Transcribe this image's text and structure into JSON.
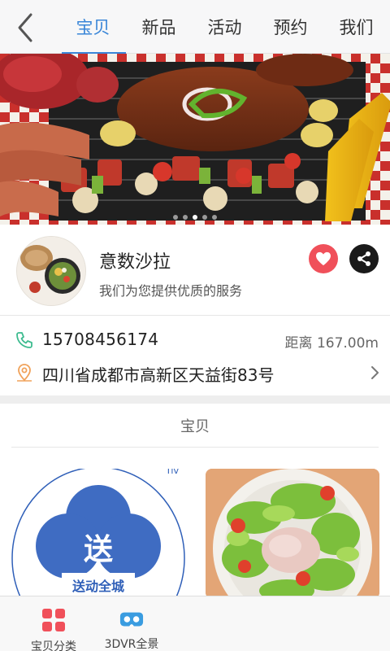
{
  "nav": {
    "tabs": [
      {
        "label": "宝贝",
        "active": true
      },
      {
        "label": "新品",
        "active": false
      },
      {
        "label": "活动",
        "active": false
      },
      {
        "label": "预约",
        "active": false
      },
      {
        "label": "我们",
        "active": false
      }
    ]
  },
  "banner": {
    "slide_count": 5,
    "active_slide": 2
  },
  "shop": {
    "name": "意数沙拉",
    "description": "我们为您提供优质的服务"
  },
  "contact": {
    "phone": "15708456174",
    "distance": "距离 167.00m",
    "address": "四川省成都市高新区天益街83号"
  },
  "section": {
    "title": "宝贝"
  },
  "products": [
    {
      "image_text": "送",
      "image_caption": "送动全城",
      "image_corner": "Tiv"
    },
    {
      "image_text": ""
    }
  ],
  "bottom_bar": {
    "items": [
      {
        "label": "宝贝分类",
        "icon": "grid-icon"
      },
      {
        "label": "3DVR全景",
        "icon": "vr-goggles-icon"
      }
    ]
  },
  "colors": {
    "accent": "#3a86d8",
    "like": "#f0505a",
    "phone_icon": "#3dbb8f",
    "location_icon": "#f0a25a",
    "category_icon": "#f0505a",
    "vr_icon": "#3a9ce0"
  }
}
